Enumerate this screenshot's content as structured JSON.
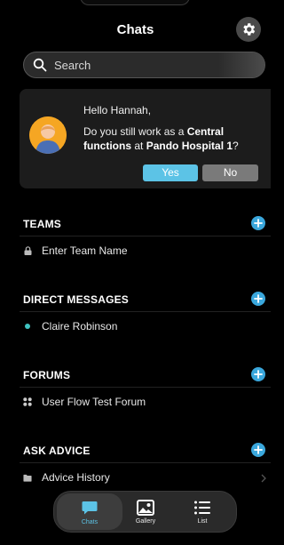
{
  "header": {
    "title": "Chats"
  },
  "search": {
    "placeholder": "Search"
  },
  "prompt_card": {
    "greeting": "Hello Hannah,",
    "question_prefix": "Do you still work as a ",
    "role": "Central functions",
    "question_middle": " at ",
    "organization": "Pando Hospital 1",
    "question_suffix": "?",
    "yes_label": "Yes",
    "no_label": "No"
  },
  "sections": {
    "teams": {
      "title": "TEAMS",
      "item": "Enter Team Name",
      "item_icon": "lock-icon"
    },
    "direct_messages": {
      "title": "DIRECT MESSAGES",
      "item": "Claire Robinson",
      "item_icon": "online-dot-icon",
      "status_color": "#3fc3c0"
    },
    "forums": {
      "title": "FORUMS",
      "item": "User Flow Test Forum",
      "item_icon": "forum-icon"
    },
    "ask_advice": {
      "title": "ASK ADVICE",
      "item": "Advice History",
      "item_icon": "folder-icon"
    }
  },
  "tabbar": {
    "tabs": [
      {
        "label": "Chats",
        "icon": "chat-bubble-icon",
        "active": true
      },
      {
        "label": "Gallery",
        "icon": "gallery-icon",
        "active": false
      },
      {
        "label": "List",
        "icon": "list-icon",
        "active": false
      }
    ]
  },
  "colors": {
    "accent": "#5cc3e6",
    "plus": "#3aa7dc",
    "background": "#000000",
    "card": "#1c1c1c",
    "avatar": "#f5a623"
  }
}
